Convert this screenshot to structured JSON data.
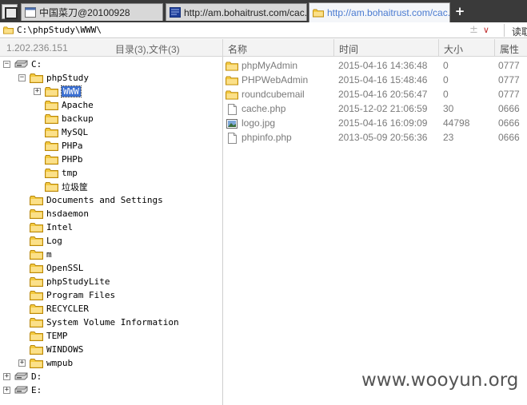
{
  "tabs": [
    {
      "label": "中国菜刀@20100928",
      "active": false
    },
    {
      "label": "http://am.bohaitrust.com/cac...",
      "active": false
    },
    {
      "label": "http://am.bohaitrust.com/cac...",
      "active": true
    }
  ],
  "new_tab_symbol": "+",
  "address": {
    "path": "C:\\phpStudy\\WWW\\",
    "add_symbol": "±",
    "dropdown_symbol": "∨",
    "read_label": "读取"
  },
  "header": {
    "ip": "1.202.236.151",
    "summary": "目录(3),文件(3)",
    "col_name": "名称",
    "col_time": "时间",
    "col_size": "大小",
    "col_attr": "属性"
  },
  "tree": {
    "drive_c": "C:",
    "phpstudy": "phpStudy",
    "phpstudy_children": [
      "WWW",
      "Apache",
      "backup",
      "MySQL",
      "PHPa",
      "PHPb",
      "tmp",
      "垃圾筐"
    ],
    "c_children": [
      "Documents and Settings",
      "hsdaemon",
      "Intel",
      "Log",
      "m",
      "OpenSSL",
      "phpStudyLite",
      "Program Files",
      "RECYCLER",
      "System Volume Information",
      "TEMP",
      "WINDOWS",
      "wmpub"
    ],
    "drive_d": "D:",
    "drive_e": "E:",
    "expand_plus": "+",
    "expand_minus": "−"
  },
  "files": [
    {
      "name": "phpMyAdmin",
      "time": "2015-04-16 14:36:48",
      "size": "0",
      "attr": "0777",
      "kind": "folder"
    },
    {
      "name": "PHPWebAdmin",
      "time": "2015-04-16 15:48:46",
      "size": "0",
      "attr": "0777",
      "kind": "folder"
    },
    {
      "name": "roundcubemail",
      "time": "2015-04-16 20:56:47",
      "size": "0",
      "attr": "0777",
      "kind": "folder"
    },
    {
      "name": "cache.php",
      "time": "2015-12-02 21:06:59",
      "size": "30",
      "attr": "0666",
      "kind": "file"
    },
    {
      "name": "logo.jpg",
      "time": "2015-04-16 16:09:09",
      "size": "44798",
      "attr": "0666",
      "kind": "image"
    },
    {
      "name": "phpinfo.php",
      "time": "2013-05-09 20:56:36",
      "size": "23",
      "attr": "0666",
      "kind": "file"
    }
  ],
  "watermark": "www.wooyun.org",
  "colors": {
    "folder": "#f0c040",
    "selection": "#3b6fd0",
    "tab_active_text": "#4a7bd1"
  }
}
